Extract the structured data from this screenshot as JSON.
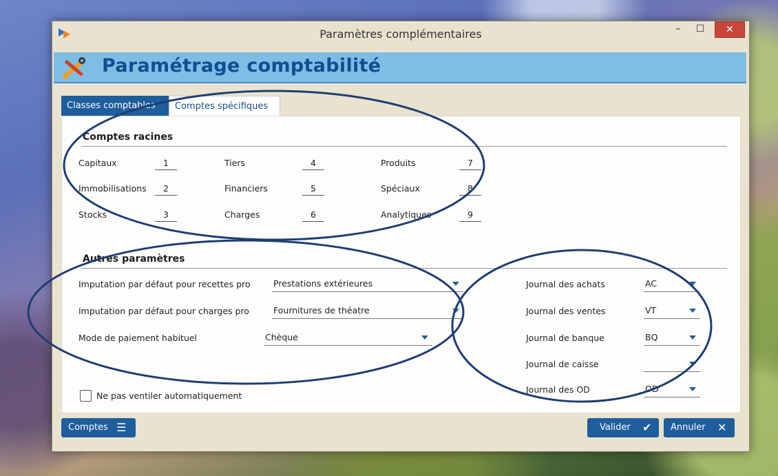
{
  "window": {
    "title": "Paramètres complémentaires",
    "minimize_glyph": "–",
    "maximize_glyph": "☐",
    "close_glyph": "✕"
  },
  "header": {
    "title": "Paramétrage comptabilité",
    "icon": "tools-icon"
  },
  "tabs": [
    {
      "label": "Classes comptables",
      "active": true
    },
    {
      "label": "Comptes spécifiques",
      "active": false
    }
  ],
  "comptes_racines": {
    "title": "Comptes racines",
    "rows": [
      {
        "label": "Capitaux",
        "value": "1"
      },
      {
        "label": "Immobilisations",
        "value": "2"
      },
      {
        "label": "Stocks",
        "value": "3"
      },
      {
        "label": "Tiers",
        "value": "4"
      },
      {
        "label": "Financiers",
        "value": "5"
      },
      {
        "label": "Charges",
        "value": "6"
      },
      {
        "label": "Produits",
        "value": "7"
      },
      {
        "label": "Spéciaux",
        "value": "8"
      },
      {
        "label": "Analytiques",
        "value": "9"
      }
    ]
  },
  "autres_parametres": {
    "title": "Autres paramètres",
    "fields": [
      {
        "label": "Imputation par défaut pour recettes pro",
        "value": "Prestations extérieures"
      },
      {
        "label": "Imputation par défaut pour charges pro",
        "value": "Fournitures de théatre"
      },
      {
        "label": "Mode de paiement habituel",
        "value": "Chèque"
      }
    ],
    "journaux": [
      {
        "label": "Journal des achats",
        "value": "AC"
      },
      {
        "label": "Journal des ventes",
        "value": "VT"
      },
      {
        "label": "Journal de banque",
        "value": "BQ"
      },
      {
        "label": "Journal de caisse",
        "value": ""
      },
      {
        "label": "Journal des OD",
        "value": "OD"
      }
    ],
    "checkbox_label": "Ne pas ventiler automatiquement",
    "checkbox_checked": false
  },
  "buttons": {
    "comptes": "Comptes",
    "comptes_glyph": "☰",
    "valider": "Valider",
    "valider_glyph": "✔",
    "annuler": "Annuler",
    "annuler_glyph": "✕"
  },
  "colors": {
    "accent": "#1e5e9c",
    "header_band": "#7fbde3",
    "title_blue": "#0f4f94",
    "close_red": "#c9463b",
    "annotation_ink": "#1c3e75"
  }
}
